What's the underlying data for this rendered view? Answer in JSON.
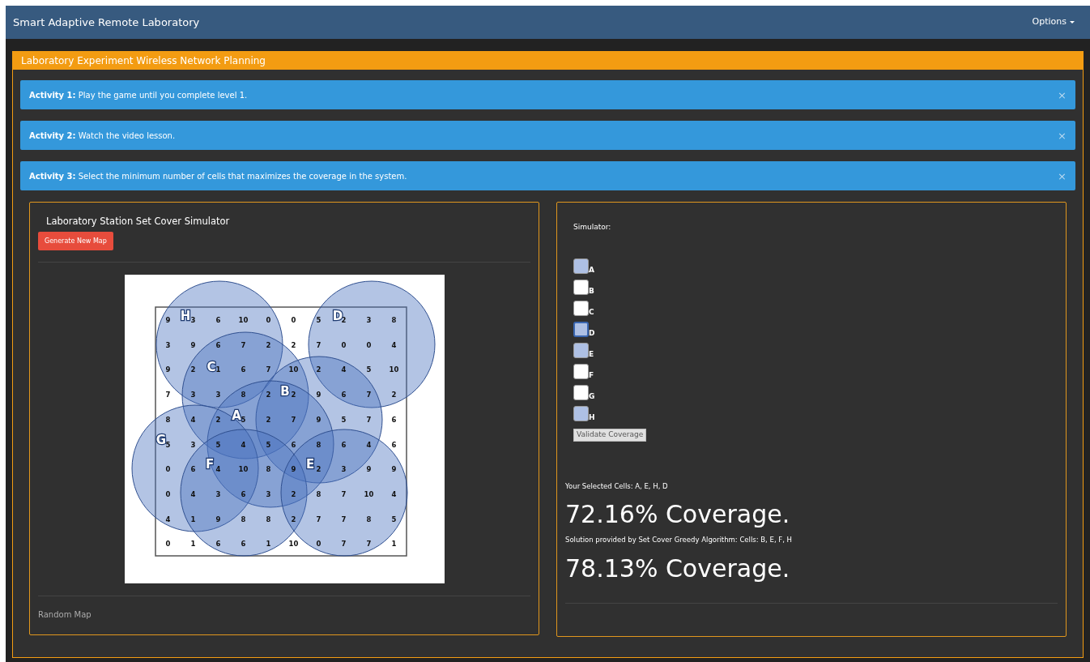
{
  "navbar": {
    "title": "Smart Adaptive Remote Laboratory",
    "menu": "Options"
  },
  "panel": {
    "title": "Laboratory Experiment Wireless Network Planning",
    "activities": [
      {
        "label": "Activity 1:",
        "text": "Play the game until you complete level 1.",
        "close": "×"
      },
      {
        "label": "Activity 2:",
        "text": "Watch the video lesson.",
        "close": "×"
      },
      {
        "label": "Activity 3:",
        "text": "Select the minimum number of cells that maximizes the coverage in the system.",
        "close": "×"
      }
    ]
  },
  "map_card": {
    "title": "Laboratory Station Set Cover Simulator",
    "button": "Generate New Map",
    "footer": "Random Map",
    "grid": [
      [
        "9",
        "3",
        "6",
        "10",
        "0",
        "0",
        "5",
        "2",
        "3",
        "8"
      ],
      [
        "3",
        "9",
        "6",
        "7",
        "2",
        "2",
        "7",
        "0",
        "0",
        "4"
      ],
      [
        "9",
        "2",
        "1",
        "6",
        "7",
        "10",
        "2",
        "4",
        "5",
        "10"
      ],
      [
        "7",
        "3",
        "3",
        "8",
        "2",
        "2",
        "9",
        "6",
        "7",
        "2"
      ],
      [
        "8",
        "4",
        "2",
        "5",
        "2",
        "7",
        "9",
        "5",
        "7",
        "6"
      ],
      [
        "5",
        "3",
        "5",
        "4",
        "5",
        "6",
        "8",
        "6",
        "4",
        "6"
      ],
      [
        "0",
        "6",
        "4",
        "10",
        "8",
        "9",
        "2",
        "3",
        "9",
        "9"
      ],
      [
        "0",
        "4",
        "3",
        "6",
        "3",
        "2",
        "8",
        "7",
        "10",
        "4"
      ],
      [
        "4",
        "1",
        "9",
        "8",
        "8",
        "2",
        "7",
        "7",
        "8",
        "5"
      ],
      [
        "0",
        "1",
        "6",
        "6",
        "1",
        "10",
        "0",
        "7",
        "7",
        "1"
      ]
    ],
    "circles": [
      {
        "label": "H"
      },
      {
        "label": "D"
      },
      {
        "label": "C"
      },
      {
        "label": "B"
      },
      {
        "label": "A"
      },
      {
        "label": "G"
      },
      {
        "label": "F"
      },
      {
        "label": "E"
      }
    ]
  },
  "simulator": {
    "title": "Simulator:",
    "cells": [
      {
        "label": "A",
        "checked": true,
        "focused": false
      },
      {
        "label": "B",
        "checked": false,
        "focused": false
      },
      {
        "label": "C",
        "checked": false,
        "focused": false
      },
      {
        "label": "D",
        "checked": true,
        "focused": true
      },
      {
        "label": "E",
        "checked": true,
        "focused": false
      },
      {
        "label": "F",
        "checked": false,
        "focused": false
      },
      {
        "label": "G",
        "checked": false,
        "focused": false
      },
      {
        "label": "H",
        "checked": true,
        "focused": false
      }
    ],
    "button": "Validate Coverage",
    "selected_text": "Your Selected Cells: A, E, H, D",
    "selected_coverage": "72.16% Coverage.",
    "solution_text": "Solution provided by Set Cover Greedy Algorithm: Cells: B, E, F, H",
    "solution_coverage": "78.13% Coverage."
  }
}
